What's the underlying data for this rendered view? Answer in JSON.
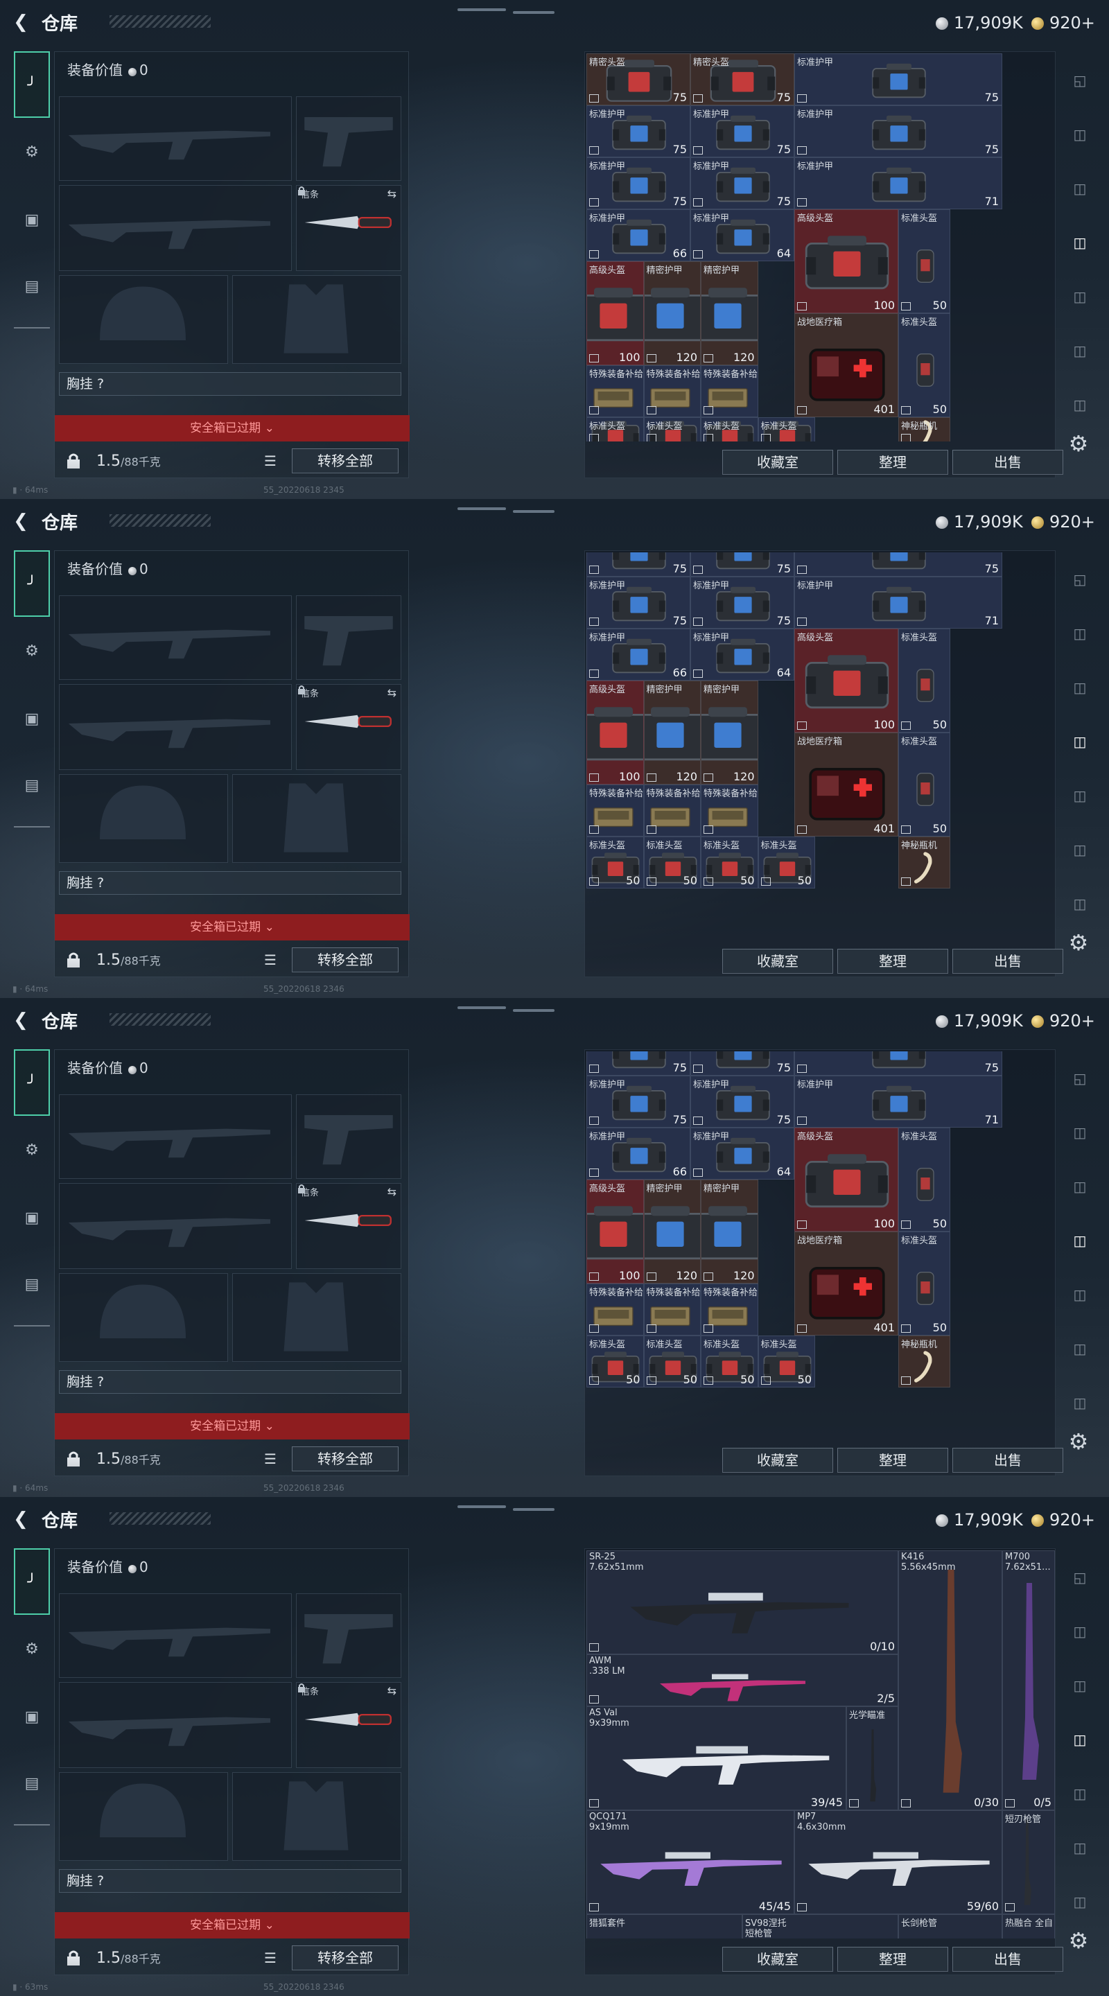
{
  "frames": [
    {
      "title": "仓库",
      "currency": {
        "silver": "17,909K",
        "gold": "920+"
      },
      "equip": {
        "value_label": "装备价值",
        "value": "0",
        "knife_tag": "信条",
        "chest_label": "胸挂 ?",
        "safe_box": "安全箱已过期",
        "weight": "1.5",
        "weight_max": "/88千克",
        "transfer_all": "转移全部"
      },
      "warehouse_buttons": {
        "collection": "收藏室",
        "organize": "整理",
        "sell": "出售"
      },
      "sysinfo": "64ms",
      "buildtag": "55_20220618 2345",
      "cells": [
        {
          "nm": "精密头盔",
          "val": "75"
        },
        {
          "nm": "精密头盔",
          "val": "75"
        },
        {
          "nm": "标准护甲",
          "val": "75"
        },
        {
          "nm": "标准护甲",
          "val": "75"
        },
        {
          "nm": "标准护甲",
          "val": "75"
        },
        {
          "nm": "标准护甲",
          "val": "75"
        },
        {
          "nm": "标准护甲",
          "val": "75"
        },
        {
          "nm": "标准护甲",
          "val": "75"
        },
        {
          "nm": "标准护甲",
          "val": "71"
        },
        {
          "nm": "标准护甲",
          "val": "66"
        },
        {
          "nm": "标准护甲",
          "val": "64"
        },
        {
          "nm": "高级头盔",
          "val": "100"
        },
        {
          "nm": "标准头盔",
          "val": "50"
        },
        {
          "nm": "高级头盔",
          "val": "100"
        },
        {
          "nm": "精密护甲",
          "val": "120"
        },
        {
          "nm": "精密护甲",
          "val": "120"
        },
        {
          "nm": "战地医疗箱",
          "val": "401"
        },
        {
          "nm": "标准头盔",
          "val": "50"
        },
        {
          "nm": "特殊装备补给",
          "val": ""
        },
        {
          "nm": "特殊装备补给",
          "val": ""
        },
        {
          "nm": "特殊装备补给",
          "val": ""
        },
        {
          "nm": "标准头盔",
          "val": ""
        },
        {
          "nm": "标准头盔",
          "val": ""
        },
        {
          "nm": "标准头盔",
          "val": ""
        },
        {
          "nm": "标准头盔",
          "val": ""
        },
        {
          "nm": "神秘瓶机",
          "val": ""
        }
      ]
    },
    {
      "title": "仓库",
      "currency": {
        "silver": "17,909K",
        "gold": "920+"
      },
      "equip": {
        "value_label": "装备价值",
        "value": "0",
        "knife_tag": "信条",
        "chest_label": "胸挂 ?",
        "safe_box": "安全箱已过期",
        "weight": "1.5",
        "weight_max": "/88千克",
        "transfer_all": "转移全部"
      },
      "warehouse_buttons": {
        "collection": "收藏室",
        "organize": "整理",
        "sell": "出售"
      },
      "sysinfo": "64ms",
      "buildtag": "55_20220618 2346",
      "cells": [
        {
          "nm": "",
          "val": "75"
        },
        {
          "nm": "",
          "val": "75"
        },
        {
          "nm": "",
          "val": "75"
        },
        {
          "nm": "标准护甲",
          "val": "75"
        },
        {
          "nm": "标准护甲",
          "val": "75"
        },
        {
          "nm": "标准护甲",
          "val": "71"
        },
        {
          "nm": "标准护甲",
          "val": "66"
        },
        {
          "nm": "标准护甲",
          "val": "64"
        },
        {
          "nm": "高级头盔",
          "val": "100"
        },
        {
          "nm": "标准头盔",
          "val": "50"
        },
        {
          "nm": "高级头盔",
          "val": "100"
        },
        {
          "nm": "精密护甲",
          "val": "120"
        },
        {
          "nm": "精密护甲",
          "val": "120"
        },
        {
          "nm": "战地医疗箱",
          "val": "401"
        },
        {
          "nm": "标准头盔",
          "val": "50"
        },
        {
          "nm": "特殊装备补给",
          "val": ""
        },
        {
          "nm": "特殊装备补给",
          "val": ""
        },
        {
          "nm": "特殊装备补给",
          "val": ""
        },
        {
          "nm": "标准头盔",
          "val": "50"
        },
        {
          "nm": "标准头盔",
          "val": "50"
        },
        {
          "nm": "标准头盔",
          "val": "50"
        },
        {
          "nm": "标准头盔",
          "val": "50"
        },
        {
          "nm": "神秘瓶机",
          "val": ""
        }
      ]
    },
    {
      "title": "仓库",
      "currency": {
        "silver": "17,909K",
        "gold": "920+"
      },
      "equip": {
        "value_label": "装备价值",
        "value": "0",
        "knife_tag": "信条",
        "chest_label": "胸挂 ?",
        "safe_box": "安全箱已过期",
        "weight": "1.5",
        "weight_max": "/88千克",
        "transfer_all": "转移全部"
      },
      "warehouse_buttons": {
        "collection": "收藏室",
        "organize": "整理",
        "sell": "出售"
      },
      "sysinfo": "64ms",
      "buildtag": "55_20220618 2346",
      "cells": [
        {
          "nm": "",
          "val": "75"
        },
        {
          "nm": "",
          "val": "75"
        },
        {
          "nm": "",
          "val": "75"
        },
        {
          "nm": "标准护甲",
          "val": "75"
        },
        {
          "nm": "标准护甲",
          "val": "75"
        },
        {
          "nm": "标准护甲",
          "val": "71"
        },
        {
          "nm": "标准护甲",
          "val": "66"
        },
        {
          "nm": "标准护甲",
          "val": "64"
        },
        {
          "nm": "高级头盔",
          "val": "100"
        },
        {
          "nm": "标准头盔",
          "val": "50"
        },
        {
          "nm": "高级头盔",
          "val": "100"
        },
        {
          "nm": "精密护甲",
          "val": "120"
        },
        {
          "nm": "精密护甲",
          "val": "120"
        },
        {
          "nm": "战地医疗箱",
          "val": "401"
        },
        {
          "nm": "标准头盔",
          "val": "50"
        },
        {
          "nm": "特殊装备补给",
          "val": ""
        },
        {
          "nm": "特殊装备补给",
          "val": ""
        },
        {
          "nm": "特殊装备补给",
          "val": ""
        },
        {
          "nm": "标准头盔",
          "val": "50"
        },
        {
          "nm": "标准头盔",
          "val": "50"
        },
        {
          "nm": "标准头盔",
          "val": "50"
        },
        {
          "nm": "标准头盔",
          "val": "50"
        },
        {
          "nm": "神秘瓶机",
          "val": ""
        }
      ]
    },
    {
      "title": "仓库",
      "currency": {
        "silver": "17,909K",
        "gold": "920+"
      },
      "equip": {
        "value_label": "装备价值",
        "value": "0",
        "knife_tag": "信条",
        "chest_label": "胸挂 ?",
        "safe_box": "安全箱已过期",
        "weight": "1.5",
        "weight_max": "/88千克",
        "transfer_all": "转移全部"
      },
      "warehouse_buttons": {
        "collection": "收藏室",
        "organize": "整理",
        "sell": "出售"
      },
      "sysinfo": "63ms",
      "buildtag": "55_20220618 2346",
      "weapons": [
        {
          "nm": "SR-25",
          "cal": "7.62x51mm",
          "val": "0/10"
        },
        {
          "nm": "K416",
          "cal": "5.56x45mm",
          "val": "0/30"
        },
        {
          "nm": "M700",
          "cal": "7.62x51...",
          "val": "0/5"
        },
        {
          "nm": "AWM",
          "cal": ".338 LM",
          "val": "2/5"
        },
        {
          "nm": "AS Val",
          "cal": "9x39mm",
          "val": "39/45"
        },
        {
          "nm": "光学瞄准",
          "cal": "",
          "val": ""
        },
        {
          "nm": "QCQ171",
          "cal": "9x19mm",
          "val": "45/45"
        },
        {
          "nm": "MP7",
          "cal": "4.6x30mm",
          "val": "59/60"
        },
        {
          "nm": "短刃枪管",
          "cal": "",
          "val": ""
        },
        {
          "nm": "猎狐套件",
          "cal": "",
          "val": ""
        },
        {
          "nm": "SV98涅托",
          "cal": "短枪管",
          "val": ""
        },
        {
          "nm": "长剑枪管",
          "cal": "",
          "val": ""
        },
        {
          "nm": "热融合 全自",
          "cal": "",
          "val": ""
        }
      ]
    }
  ]
}
